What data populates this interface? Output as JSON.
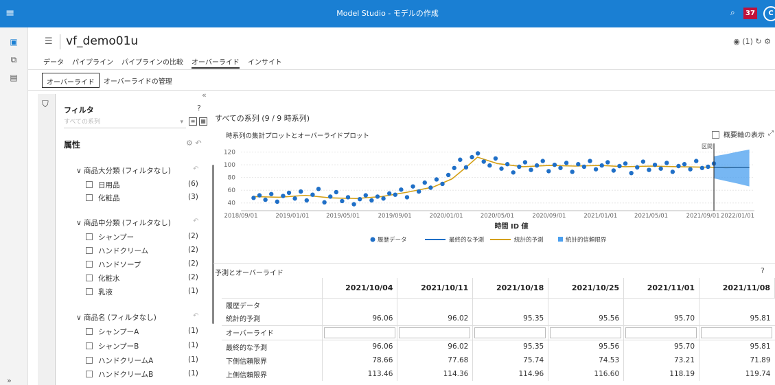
{
  "app": {
    "title": "Model Studio - モデルの作成",
    "badge_count": "37",
    "avatar_initial": "C",
    "model_name": "vf_demo01u",
    "header_right_count": "(1)"
  },
  "main_tabs": [
    {
      "label": "データ"
    },
    {
      "label": "パイプライン"
    },
    {
      "label": "パイプラインの比較"
    },
    {
      "label": "オーバーライド"
    },
    {
      "label": "インサイト"
    }
  ],
  "sub_tabs": [
    {
      "label": "オーバーライド"
    },
    {
      "label": "オーバーライドの管理"
    }
  ],
  "filter": {
    "title": "フィルタ",
    "select_placeholder": "すべての系列",
    "attributes_title": "属性",
    "groups": [
      {
        "label": "商品大分類 (フィルタなし)",
        "items": [
          {
            "label": "日用品",
            "count": "(6)"
          },
          {
            "label": "化粧品",
            "count": "(3)"
          }
        ]
      },
      {
        "label": "商品中分類 (フィルタなし)",
        "items": [
          {
            "label": "シャンプー",
            "count": "(2)"
          },
          {
            "label": "ハンドクリーム",
            "count": "(2)"
          },
          {
            "label": "ハンドソープ",
            "count": "(2)"
          },
          {
            "label": "化粧水",
            "count": "(2)"
          },
          {
            "label": "乳液",
            "count": "(1)"
          }
        ]
      },
      {
        "label": "商品名 (フィルタなし)",
        "items": [
          {
            "label": "シャンプーA",
            "count": "(1)"
          },
          {
            "label": "シャンプーB",
            "count": "(1)"
          },
          {
            "label": "ハンドクリームA",
            "count": "(1)"
          },
          {
            "label": "ハンドクリームB",
            "count": "(1)"
          }
        ]
      }
    ]
  },
  "content": {
    "series_title": "すべての系列 (9 / 9 時系列)",
    "chart_title": "時系列の集計プロットとオーバーライドプロット",
    "overview_label": "概要軸の表示"
  },
  "chart_data": {
    "type": "line",
    "xlabel": "時間 ID 値",
    "ylabel": "",
    "x_ticks": [
      "2018/09/01",
      "2019/01/01",
      "2019/05/01",
      "2019/09/01",
      "2020/01/01",
      "2020/05/01",
      "2020/09/01",
      "2021/01/01",
      "2021/05/01",
      "2021/09/01",
      "2022/01/01"
    ],
    "y_ticks": [
      40,
      60,
      80,
      100,
      120
    ],
    "ylim": [
      30,
      125
    ],
    "xlim": [
      "2018/09/01",
      "2022/01/01"
    ],
    "interval_label": "区間",
    "interval_start": "2021/09/27",
    "series": [
      {
        "name": "履歴データ",
        "kind": "points",
        "color": "#1f6fc7",
        "x": [
          "2018/10/01",
          "2018/10/15",
          "2018/10/29",
          "2018/11/12",
          "2018/11/26",
          "2018/12/10",
          "2018/12/24",
          "2019/01/07",
          "2019/01/21",
          "2019/02/04",
          "2019/02/18",
          "2019/03/04",
          "2019/03/18",
          "2019/04/01",
          "2019/04/15",
          "2019/04/29",
          "2019/05/13",
          "2019/05/27",
          "2019/06/10",
          "2019/06/24",
          "2019/07/08",
          "2019/07/22",
          "2019/08/05",
          "2019/08/19",
          "2019/09/02",
          "2019/09/16",
          "2019/09/30",
          "2019/10/14",
          "2019/10/28",
          "2019/11/11",
          "2019/11/25",
          "2019/12/09",
          "2019/12/23",
          "2020/01/06",
          "2020/01/20",
          "2020/02/03",
          "2020/02/17",
          "2020/03/02",
          "2020/03/16",
          "2020/03/30",
          "2020/04/13",
          "2020/04/27",
          "2020/05/11",
          "2020/05/25",
          "2020/06/08",
          "2020/06/22",
          "2020/07/06",
          "2020/07/20",
          "2020/08/03",
          "2020/08/17",
          "2020/08/31",
          "2020/09/14",
          "2020/09/28",
          "2020/10/12",
          "2020/10/26",
          "2020/11/09",
          "2020/11/23",
          "2020/12/07",
          "2020/12/21",
          "2021/01/04",
          "2021/01/18",
          "2021/02/01",
          "2021/02/15",
          "2021/03/01",
          "2021/03/15",
          "2021/03/29",
          "2021/04/12",
          "2021/04/26",
          "2021/05/10",
          "2021/05/24",
          "2021/06/07",
          "2021/06/21",
          "2021/07/05",
          "2021/07/19",
          "2021/08/02",
          "2021/08/16",
          "2021/08/30",
          "2021/09/13",
          "2021/09/27"
        ],
        "y": [
          48,
          52,
          45,
          54,
          42,
          51,
          56,
          47,
          58,
          44,
          53,
          62,
          41,
          50,
          57,
          43,
          49,
          38,
          46,
          52,
          44,
          50,
          47,
          55,
          53,
          61,
          49,
          66,
          58,
          72,
          64,
          77,
          70,
          84,
          95,
          108,
          96,
          112,
          118,
          105,
          99,
          110,
          94,
          101,
          88,
          97,
          104,
          92,
          99,
          106,
          90,
          100,
          95,
          103,
          89,
          101,
          97,
          106,
          93,
          99,
          104,
          91,
          98,
          102,
          87,
          96,
          105,
          92,
          100,
          94,
          103,
          89,
          98,
          101,
          93,
          106,
          95,
          97,
          102
        ]
      },
      {
        "name": "最終的な予測",
        "kind": "line",
        "color": "#1f6fc7",
        "x": [
          "2021/09/27",
          "2021/10/25",
          "2021/11/22",
          "2021/12/20"
        ],
        "y": [
          96.06,
          95.56,
          95.8,
          95.9
        ]
      },
      {
        "name": "統計的予測",
        "kind": "line",
        "color": "#d4a017",
        "x": [
          "2018/10/01",
          "2018/12/01",
          "2019/02/01",
          "2019/04/01",
          "2019/06/01",
          "2019/08/01",
          "2019/10/01",
          "2019/12/01",
          "2020/01/15",
          "2020/02/15",
          "2020/03/15",
          "2020/05/01",
          "2020/07/01",
          "2020/09/01",
          "2020/11/01",
          "2021/01/01",
          "2021/03/01",
          "2021/05/01",
          "2021/07/01",
          "2021/09/27",
          "2021/12/20"
        ],
        "y": [
          50,
          49,
          52,
          48,
          47,
          50,
          57,
          65,
          78,
          95,
          112,
          102,
          97,
          99,
          98,
          99,
          97,
          98,
          97,
          96.06,
          95.9
        ]
      },
      {
        "name": "統計的信頼限界",
        "kind": "band",
        "color": "#4a9fef",
        "x": [
          "2021/09/27",
          "2021/10/25",
          "2021/11/22",
          "2021/12/20"
        ],
        "lower": [
          78.66,
          74.53,
          70.5,
          66
        ],
        "upper": [
          113.46,
          116.6,
          120.5,
          124
        ]
      }
    ]
  },
  "forecast_table": {
    "title": "予測とオーバーライド",
    "columns": [
      "2021/10/04",
      "2021/10/11",
      "2021/10/18",
      "2021/10/25",
      "2021/11/01",
      "2021/11/08"
    ],
    "rows": [
      {
        "label": "履歴データ",
        "values": [
          "",
          "",
          "",
          "",
          "",
          ""
        ]
      },
      {
        "label": "統計的予測",
        "values": [
          "96.06",
          "96.02",
          "95.35",
          "95.56",
          "95.70",
          "95.81"
        ]
      },
      {
        "label": "オーバーライド",
        "values": [
          "",
          "",
          "",
          "",
          "",
          ""
        ]
      },
      {
        "label": "最終的な予測",
        "values": [
          "96.06",
          "96.02",
          "95.35",
          "95.56",
          "95.70",
          "95.81"
        ]
      },
      {
        "label": "下側信頼限界",
        "values": [
          "78.66",
          "77.68",
          "75.74",
          "74.53",
          "73.21",
          "71.89"
        ]
      },
      {
        "label": "上側信頼限界",
        "values": [
          "113.46",
          "114.36",
          "114.96",
          "116.60",
          "118.19",
          "119.74"
        ]
      }
    ]
  }
}
